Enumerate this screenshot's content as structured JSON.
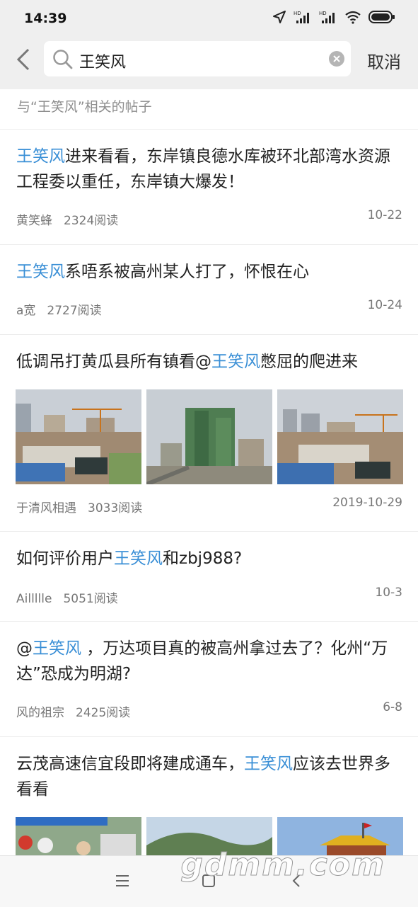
{
  "status_bar": {
    "time": "14:39"
  },
  "search": {
    "query": "王笑风",
    "cancel_label": "取消"
  },
  "section": {
    "title": "与“王笑风”相关的帖子"
  },
  "colors": {
    "highlight": "#3a8fd6",
    "background": "#efefef"
  },
  "posts": [
    {
      "title_parts": [
        {
          "text": "王笑风",
          "hl": true
        },
        {
          "text": "进来看看，东岸镇良德水库被环北部湾水资源工程委以重任，东岸镇大爆发！",
          "hl": false
        }
      ],
      "author": "黄笑蜂",
      "reads": "2324阅读",
      "date": "10-22"
    },
    {
      "title_parts": [
        {
          "text": "王笑风",
          "hl": true
        },
        {
          "text": "系唔系被高州某人打了，怀恨在心",
          "hl": false
        }
      ],
      "author": "a宽",
      "reads": "2727阅读",
      "date": "10-24"
    },
    {
      "title_parts": [
        {
          "text": "低调吊打黄瓜县所有镇看@",
          "hl": false
        },
        {
          "text": "王笑风",
          "hl": true
        },
        {
          "text": "憋屈的爬进来",
          "hl": false
        }
      ],
      "author": "于清风相遇",
      "reads": "3033阅读",
      "date": "2019-10-29",
      "images": [
        "construction-site-photo",
        "highrise-construction-photo",
        "construction-site-photo"
      ]
    },
    {
      "title_parts": [
        {
          "text": "如何评价用户",
          "hl": false
        },
        {
          "text": "王笑风",
          "hl": true
        },
        {
          "text": "和zbj988?",
          "hl": false
        }
      ],
      "author": "Aillllle",
      "reads": "5051阅读",
      "date": "10-3"
    },
    {
      "title_parts": [
        {
          "text": "@",
          "hl": false
        },
        {
          "text": "王笑风",
          "hl": true
        },
        {
          "text": " ，万达项目真的被高州拿过去了？化州“万达”恐成为明湖?",
          "hl": false
        }
      ],
      "author": "风的祖宗",
      "reads": "2425阅读",
      "date": "6-8"
    },
    {
      "title_parts": [
        {
          "text": "云茂高速信宜段即将建成通车，",
          "hl": false
        },
        {
          "text": "王笑风",
          "hl": true
        },
        {
          "text": "应该去世界多看看",
          "hl": false
        }
      ],
      "images": [
        "event-tent-photo",
        "mountain-road-photo",
        "temple-roof-photo"
      ]
    }
  ],
  "watermark": "gdmm.com",
  "nav": {
    "buttons": [
      "menu-icon",
      "home-icon",
      "back-icon"
    ]
  }
}
